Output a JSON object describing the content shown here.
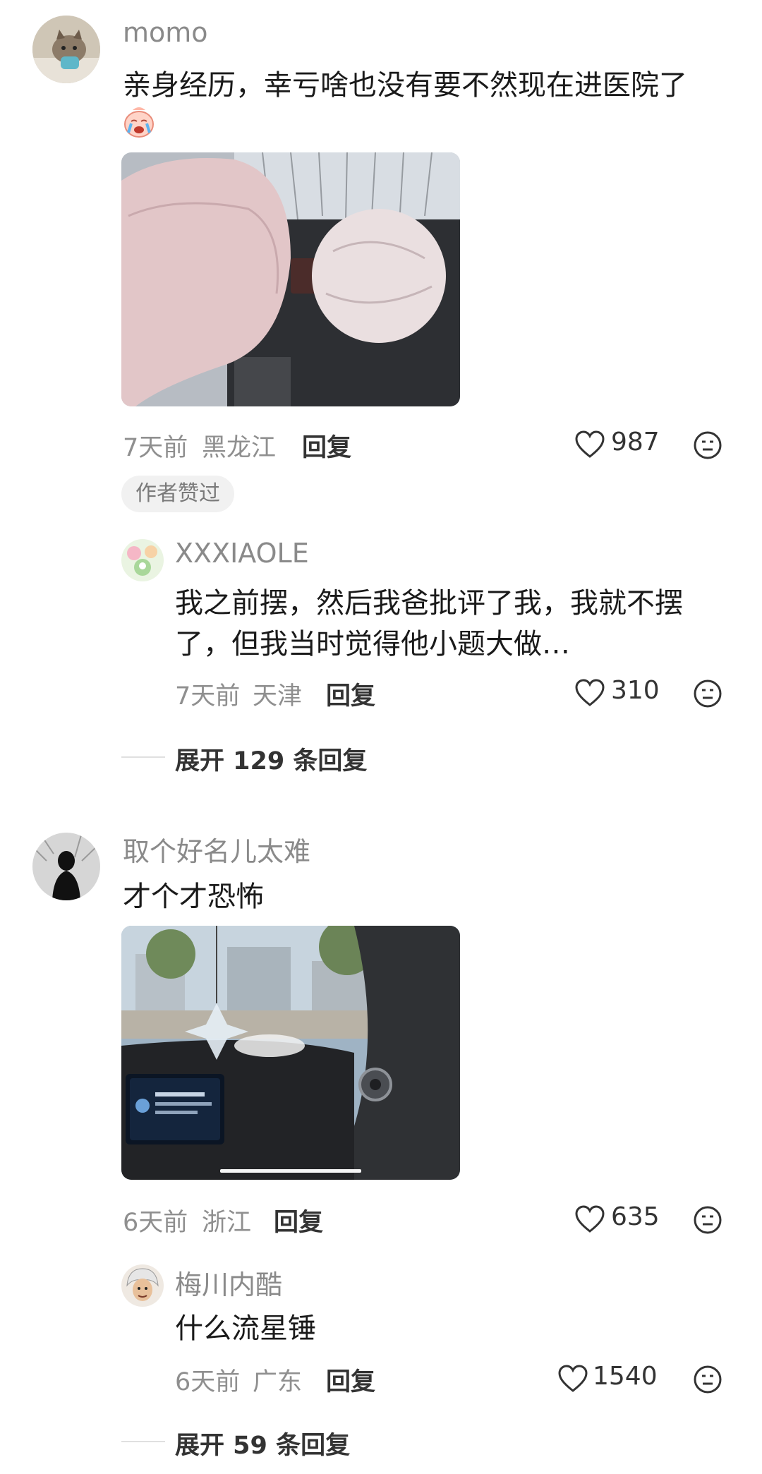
{
  "comments": [
    {
      "username": "momo",
      "text": "亲身经历，幸亏啥也没有要不然现在进医院了",
      "emoji": "crying-emoji",
      "image": "airbag-deployed-photo",
      "time": "7天前",
      "location": "黑龙江",
      "reply_label": "回复",
      "likes": "987",
      "badge": "作者赞过",
      "replies": [
        {
          "username": "XXXIAOLE",
          "text_line1": "我之前摆，然后我爸批评了我，我就不摆",
          "text_line2": "了，但我当时觉得他小题大做…",
          "time": "7天前",
          "location": "天津",
          "reply_label": "回复",
          "likes": "310"
        }
      ],
      "expand_label": "展开 129 条回复"
    },
    {
      "username": "取个好名儿太难",
      "text": "才个才恐怖",
      "image": "car-dashboard-ornament-photo",
      "time": "6天前",
      "location": "浙江",
      "reply_label": "回复",
      "likes": "635",
      "replies": [
        {
          "username": "梅川内酷",
          "text": "什么流星锤",
          "time": "6天前",
          "location": "广东",
          "reply_label": "回复",
          "likes": "1540"
        }
      ],
      "expand_label": "展开 59 条回复"
    }
  ],
  "colors": {
    "username": "#8a8a8a",
    "text": "#1a1a1a",
    "meta": "#8f8f8f",
    "accent_dark": "#333333"
  }
}
